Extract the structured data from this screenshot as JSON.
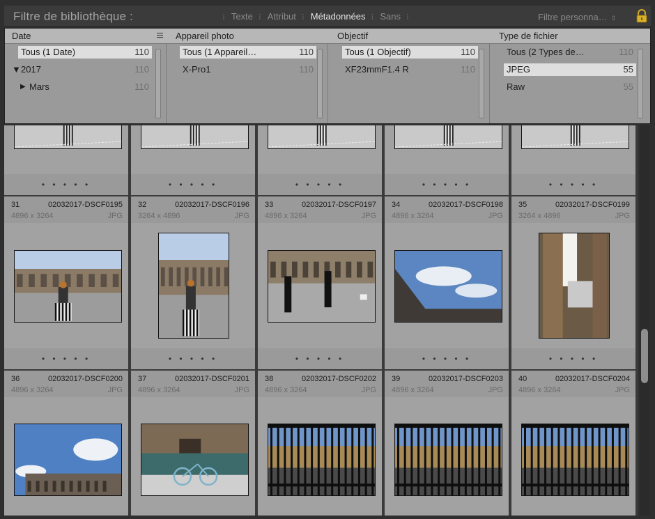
{
  "filter_bar": {
    "title": "Filtre de bibliothèque :",
    "tabs": [
      {
        "label": "Texte",
        "active": false
      },
      {
        "label": "Attribut",
        "active": false
      },
      {
        "label": "Métadonnées",
        "active": true
      },
      {
        "label": "Sans",
        "active": false
      }
    ],
    "custom_filter": "Filtre personna…",
    "lock_icon": "padlock-icon"
  },
  "metadata": {
    "columns": [
      {
        "header": "Date",
        "rows": [
          {
            "label": "Tous (1 Date)",
            "count": "110",
            "selected": true
          },
          {
            "label": "2017",
            "count": "110",
            "expander": "▼"
          },
          {
            "label": "Mars",
            "count": "110",
            "expander": "▶"
          }
        ]
      },
      {
        "header": "Appareil photo",
        "rows": [
          {
            "label": "Tous (1 Appareil…",
            "count": "110",
            "selected": true
          },
          {
            "label": "X-Pro1",
            "count": "110"
          }
        ]
      },
      {
        "header": "Objectif",
        "rows": [
          {
            "label": "Tous (1 Objectif)",
            "count": "110",
            "selected": true
          },
          {
            "label": "XF23mmF1.4 R",
            "count": "110"
          }
        ]
      },
      {
        "header": "Type de fichier",
        "rows": [
          {
            "label": "Tous (2 Types de…",
            "count": "110"
          },
          {
            "label": "JPEG",
            "count": "55",
            "selected": true
          },
          {
            "label": "Raw",
            "count": "55"
          }
        ]
      }
    ]
  },
  "grid": {
    "dots": "• • • • •",
    "rows": [
      {
        "cells": [
          {
            "num": "31",
            "fname": "02032017-DSCF0195",
            "dims": "4896 x 3264",
            "ext": "JPG",
            "orientation": "landscape",
            "scene": "columns-woman"
          },
          {
            "num": "32",
            "fname": "02032017-DSCF0196",
            "dims": "3264 x 4896",
            "ext": "JPG",
            "orientation": "portrait",
            "scene": "columns-woman"
          },
          {
            "num": "33",
            "fname": "02032017-DSCF0197",
            "dims": "4896 x 3264",
            "ext": "JPG",
            "orientation": "landscape",
            "scene": "courtyard-people"
          },
          {
            "num": "34",
            "fname": "02032017-DSCF0198",
            "dims": "4896 x 3264",
            "ext": "JPG",
            "orientation": "landscape",
            "scene": "sky-building"
          },
          {
            "num": "35",
            "fname": "02032017-DSCF0199",
            "dims": "3264 x 4896",
            "ext": "JPG",
            "orientation": "portrait",
            "scene": "colonnade"
          }
        ]
      },
      {
        "cells": [
          {
            "num": "36",
            "fname": "02032017-DSCF0200",
            "dims": "4896 x 3264",
            "ext": "JPG",
            "orientation": "landscape",
            "scene": "sky-roof"
          },
          {
            "num": "37",
            "fname": "02032017-DSCF0201",
            "dims": "4896 x 3264",
            "ext": "JPG",
            "orientation": "landscape",
            "scene": "bicycle"
          },
          {
            "num": "38",
            "fname": "02032017-DSCF0202",
            "dims": "4896 x 3264",
            "ext": "JPG",
            "orientation": "landscape",
            "scene": "gate"
          },
          {
            "num": "39",
            "fname": "02032017-DSCF0203",
            "dims": "4896 x 3264",
            "ext": "JPG",
            "orientation": "landscape",
            "scene": "gate"
          },
          {
            "num": "40",
            "fname": "02032017-DSCF0204",
            "dims": "4896 x 3264",
            "ext": "JPG",
            "orientation": "landscape",
            "scene": "gate"
          }
        ]
      }
    ]
  }
}
